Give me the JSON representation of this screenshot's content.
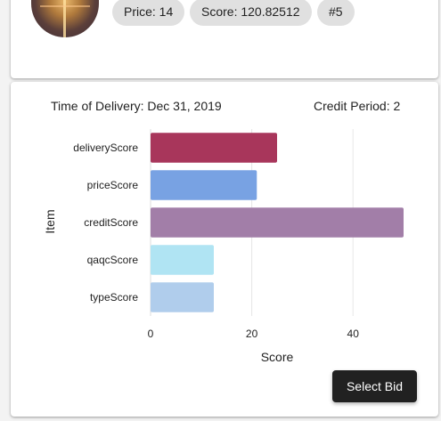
{
  "bid": {
    "price": "Price: 14",
    "score": "Score: 120.82512",
    "rank": "#5",
    "close_icon": "close-icon"
  },
  "details": {
    "delivery": "Time of Delivery: Dec 31, 2019",
    "credit_period": "Credit Period: 2"
  },
  "actions": {
    "select_bid": "Select Bid"
  },
  "chart_data": {
    "type": "bar",
    "orientation": "horizontal",
    "title": "",
    "xlabel": "Score",
    "ylabel": "Item",
    "categories": [
      "deliveryScore",
      "priceScore",
      "creditScore",
      "qaqcScore",
      "typeScore"
    ],
    "values": [
      25,
      21,
      50,
      12.5,
      12.5
    ],
    "colors": [
      "#a8365b",
      "#78a2e3",
      "#a27ea8",
      "#b0e4f3",
      "#b0cdec"
    ],
    "xlim": [
      0,
      50
    ],
    "xticks": [
      0,
      20,
      40
    ],
    "grid": true
  }
}
